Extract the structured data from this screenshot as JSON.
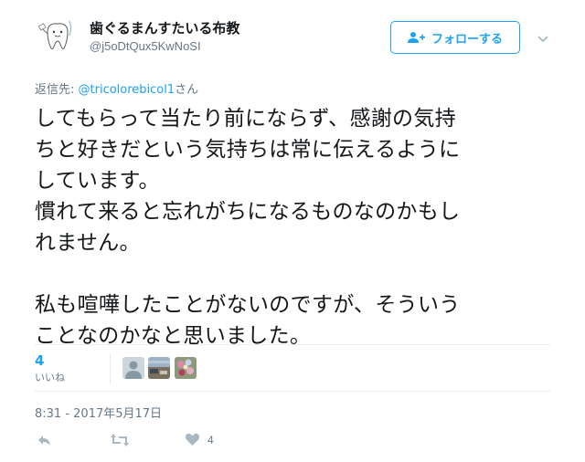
{
  "header": {
    "display_name": "歯ぐるまんすたいる布教",
    "screen_name": "@j5oDtQux5KwNoSI",
    "follow_label": "フォローする"
  },
  "tweet": {
    "reply_prefix": "返信先: ",
    "reply_mention": "@tricolorebicol1",
    "reply_suffix": "さん",
    "text": "してもらって当たり前にならず、感謝の気持\nちと好きだという気持ちは常に伝えるように\nしています。\n慣れて来ると忘れがちになるものなのかもし\nれません。\n\n私も喧嘩したことがないのですが、そういう\nことなのかなと思いました。",
    "timestamp": "8:31 - 2017年5月17日"
  },
  "stats": {
    "likes_count": "4",
    "likes_label": "いいね"
  },
  "actions": {
    "reply_icon": "reply-icon",
    "retweet_icon": "retweet-icon",
    "like_icon": "heart-icon",
    "like_count": "4"
  },
  "colors": {
    "accent": "#1da1f2",
    "muted": "#657786",
    "text": "#14171a",
    "border": "#e6ecf0"
  }
}
